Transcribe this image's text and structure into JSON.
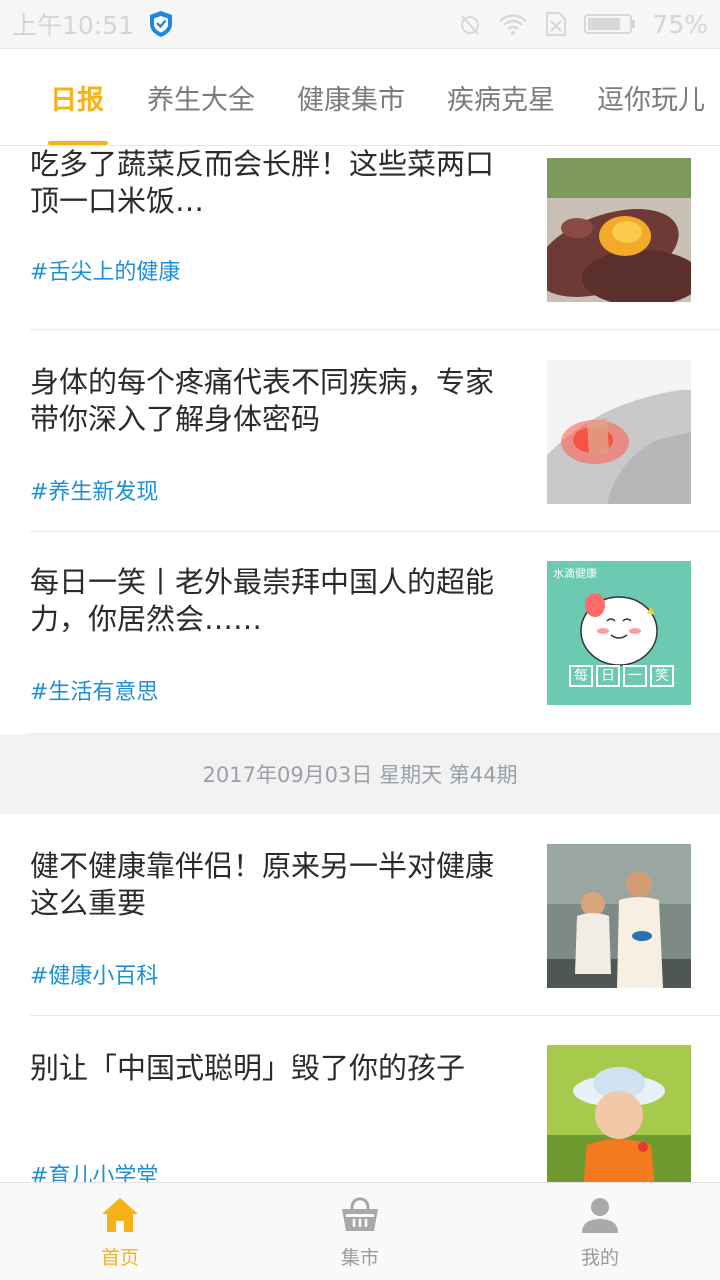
{
  "status_bar": {
    "time": "上午10:51",
    "battery": "75%"
  },
  "tabs": [
    {
      "label": "日报",
      "active": true
    },
    {
      "label": "养生大全"
    },
    {
      "label": "健康集市"
    },
    {
      "label": "疾病克星"
    },
    {
      "label": "逗你玩儿"
    }
  ],
  "articles_top": [
    {
      "title": "吃多了蔬菜反而会长胖！这些菜两口顶一口米饭…",
      "tag": "#舌尖上的健康",
      "image": "sweet-potato"
    },
    {
      "title": "身体的每个疼痛代表不同疾病，专家带你深入了解身体密码",
      "tag": "#养生新发现",
      "image": "shoulder-pain"
    },
    {
      "title": "每日一笑丨老外最崇拜中国人的超能力，你居然会……",
      "tag": "#生活有意思",
      "image": "cartoon-cat",
      "image_caption": "水滴健康",
      "image_banner": [
        "每",
        "日",
        "一",
        "笑"
      ]
    }
  ],
  "date_separator": "2017年09月03日 星期天 第44期",
  "articles_bottom": [
    {
      "title": "健不健康靠伴侣！原来另一半对健康这么重要",
      "tag": "#健康小百科",
      "image": "couple-kitchen"
    },
    {
      "title": "别让「中国式聪明」毁了你的孩子",
      "tag": "#育儿小学堂",
      "image": "child-hat"
    }
  ],
  "bottom_nav": [
    {
      "label": "首页",
      "icon": "home-icon",
      "active": true
    },
    {
      "label": "集市",
      "icon": "basket-icon"
    },
    {
      "label": "我的",
      "icon": "profile-icon"
    }
  ],
  "colors": {
    "accent": "#f6b21a",
    "tag": "#1e90d8",
    "title": "#2b2b2b",
    "tab_inactive": "#7c7c7c"
  }
}
